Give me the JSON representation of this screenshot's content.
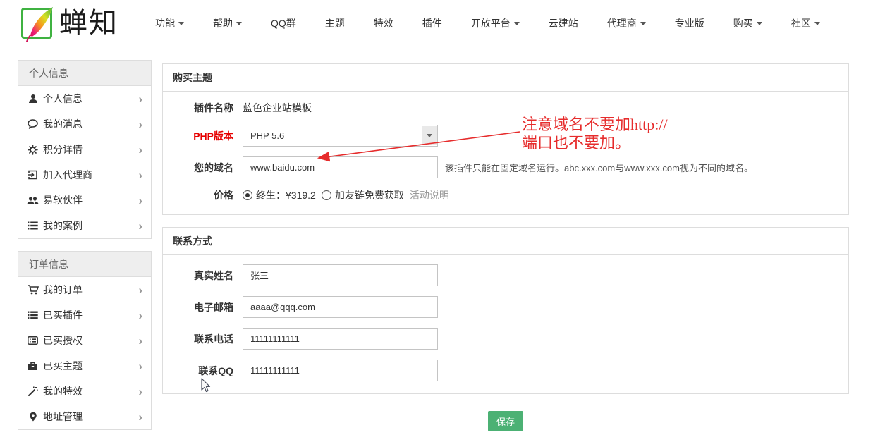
{
  "header": {
    "brand": "蝉知",
    "nav_items": [
      {
        "label": "功能"
      },
      {
        "label": "帮助"
      },
      {
        "label": "QQ群"
      },
      {
        "label": "主题"
      },
      {
        "label": "特效"
      },
      {
        "label": "插件"
      },
      {
        "label": "开放平台"
      },
      {
        "label": "云建站"
      },
      {
        "label": "代理商"
      },
      {
        "label": "专业版"
      },
      {
        "label": "购买"
      },
      {
        "label": "社区"
      }
    ]
  },
  "sidebar": {
    "sections": [
      {
        "title": "个人信息",
        "items": [
          {
            "label": "个人信息",
            "icon": "user-icon"
          },
          {
            "label": "我的消息",
            "icon": "comment-icon"
          },
          {
            "label": "积分详情",
            "icon": "gear-icon"
          },
          {
            "label": "加入代理商",
            "icon": "sign-in-icon"
          },
          {
            "label": "易软伙伴",
            "icon": "users-icon"
          },
          {
            "label": "我的案例",
            "icon": "list-icon"
          }
        ]
      },
      {
        "title": "订单信息",
        "items": [
          {
            "label": "我的订单",
            "icon": "cart-icon"
          },
          {
            "label": "已买插件",
            "icon": "list-icon"
          },
          {
            "label": "已买授权",
            "icon": "list-alt-icon"
          },
          {
            "label": "已买主题",
            "icon": "briefcase-icon"
          },
          {
            "label": "我的特效",
            "icon": "wand-icon"
          },
          {
            "label": "地址管理",
            "icon": "map-marker-icon"
          }
        ]
      }
    ]
  },
  "purchase": {
    "title": "购买主题",
    "plugin_label": "插件名称",
    "plugin_value": "蓝色企业站模板",
    "php_label": "PHP版本",
    "php_value": "PHP 5.6",
    "domain_label": "您的域名",
    "domain_value": "www.baidu.com",
    "domain_help": "该插件只能在固定域名运行。abc.xxx.com与www.xxx.com视为不同的域名。",
    "price_label": "价格",
    "price_option1": "终生：¥319.2",
    "price_option2": "加友链免费获取",
    "price_link": "活动说明"
  },
  "contact": {
    "title": "联系方式",
    "fields": [
      {
        "label": "真实姓名",
        "value": "张三"
      },
      {
        "label": "电子邮箱",
        "value": "aaaa@qqq.com"
      },
      {
        "label": "联系电话",
        "value": "11111111111"
      },
      {
        "label": "联系QQ",
        "value": "11111111111"
      }
    ]
  },
  "annotation": {
    "line1": "注意域名不要加http://",
    "line2": "端口也不要加。"
  },
  "save_label": "保存",
  "icons": {
    "chevron_right": "›"
  },
  "colors": {
    "brand_green": "#3fb241",
    "button_green": "#4cb174",
    "annotation_red": "#e62c2c",
    "php_label_red": "#e60000"
  }
}
